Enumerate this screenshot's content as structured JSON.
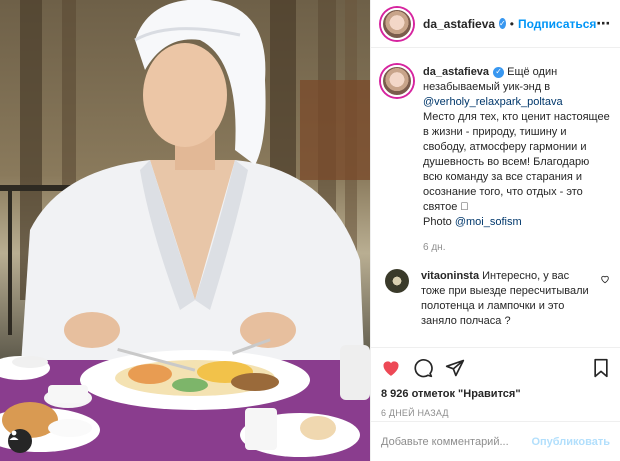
{
  "post": {
    "photo_alt": "",
    "tag_icon": "user-tag-icon"
  },
  "header": {
    "username": "da_astafieva",
    "separator": "•",
    "follow_label": "Подписаться",
    "verified_icon": "verified-check-icon"
  },
  "caption": {
    "username": "da_astafieva",
    "text_before_mention": "Ещё один незабываемый уик-энд в",
    "mention": "@verholy_relaxpark_poltava",
    "text_after_mention": "Место для тех, кто ценит настоящее в жизни - природу, тишину и свободу, атмосферу гармонии и душевность во всем! Благодарю всю команду за все старания и осознание того, что отдых - это святое 🏻",
    "photo_label": "Photo",
    "photo_mention": "@moi_sofism",
    "time": "6 дн."
  },
  "comments": [
    {
      "username": "vitaoninsta",
      "text": "Интересно, у вас тоже при выезде пересчитывали полотенца и лампочки и это заняло полчаса ?"
    }
  ],
  "actions": {
    "icons": [
      "heart-filled-icon",
      "comment-icon",
      "share-icon",
      "bookmark-icon"
    ],
    "like_color": "#ed4956"
  },
  "likes": {
    "text": "8 926 отметок \"Нравится\""
  },
  "post_time": "6 ДНЕЙ НАЗАД",
  "add_comment": {
    "placeholder": "Добавьте комментарий...",
    "publish_label": "Опубликовать"
  }
}
